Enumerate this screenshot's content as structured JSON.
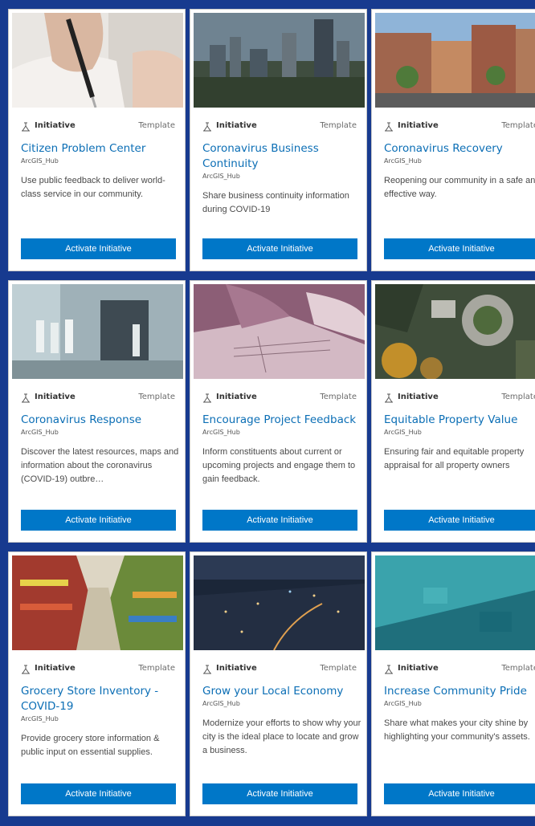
{
  "cards": [
    {
      "type_label": "Initiative",
      "kind_label": "Template",
      "title": "Citizen Problem Center",
      "owner": "ArcGIS_Hub",
      "description": "Use public feedback to deliver world-class service in our community.",
      "button_label": "Activate Initiative",
      "image": "hand writing with pen on paper"
    },
    {
      "type_label": "Initiative",
      "kind_label": "Template",
      "title": "Coronavirus Business Continuity",
      "owner": "ArcGIS_Hub",
      "description": "Share business continuity information during COVID-19",
      "button_label": "Activate Initiative",
      "image": "city skyline"
    },
    {
      "type_label": "Initiative",
      "kind_label": "Template",
      "title": "Coronavirus Recovery",
      "owner": "ArcGIS_Hub",
      "description": "Reopening our community in a safe and effective way.",
      "button_label": "Activate Initiative",
      "image": "main street buildings"
    },
    {
      "type_label": "Initiative",
      "kind_label": "Template",
      "title": "Coronavirus Response",
      "owner": "ArcGIS_Hub",
      "description": "Discover the latest resources, maps and information about the coronavirus (COVID-19) outbre…",
      "button_label": "Activate Initiative",
      "image": "hospital corridor with staff"
    },
    {
      "type_label": "Initiative",
      "kind_label": "Template",
      "title": "Encourage Project Feedback",
      "owner": "ArcGIS_Hub",
      "description": "Inform constituents about current or upcoming projects and engage them to gain feedback.",
      "button_label": "Activate Initiative",
      "image": "architectural drawings"
    },
    {
      "type_label": "Initiative",
      "kind_label": "Template",
      "title": "Equitable Property Value",
      "owner": "ArcGIS_Hub",
      "description": "Ensuring fair and equitable property appraisal for all property owners",
      "button_label": "Activate Initiative",
      "image": "aerial view of cul-de-sac"
    },
    {
      "type_label": "Initiative",
      "kind_label": "Template",
      "title": "Grocery Store Inventory - COVID-19",
      "owner": "ArcGIS_Hub",
      "description": "Provide grocery store information & public input on essential supplies.",
      "button_label": "Activate Initiative",
      "image": "grocery store aisle"
    },
    {
      "type_label": "Initiative",
      "kind_label": "Template",
      "title": "Grow your Local Economy",
      "owner": "ArcGIS_Hub",
      "description": "Modernize your efforts to show why your city is the ideal place to locate and grow a business.",
      "button_label": "Activate Initiative",
      "image": "city at night"
    },
    {
      "type_label": "Initiative",
      "kind_label": "Template",
      "title": "Increase Community Pride",
      "owner": "ArcGIS_Hub",
      "description": "Share what makes your city shine by highlighting your community's assets.",
      "button_label": "Activate Initiative",
      "image": "aerial city with teal tint"
    }
  ],
  "colors": {
    "page_background": "#173a8f",
    "title": "#0b6eb5",
    "button": "#0077c8"
  }
}
